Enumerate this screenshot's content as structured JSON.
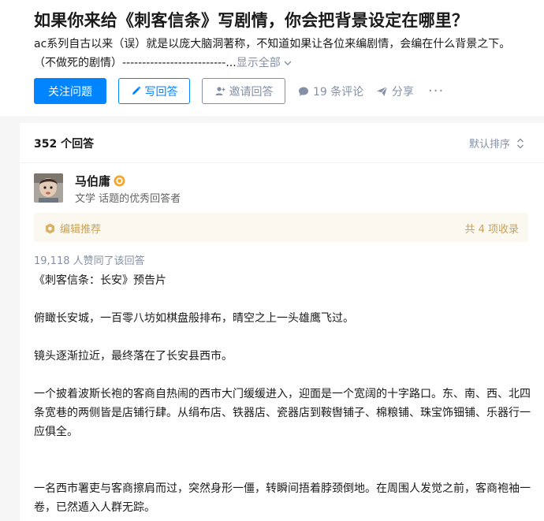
{
  "question": {
    "title": "如果你来给《刺客信条》写剧情，你会把背景设定在哪里？",
    "detail_line1": "ac系列自古以来（误）就是以庞大脑洞著称，不知道如果让各位来编剧情，会编在什么背景之下。",
    "detail_line2": "（不做死的剧情）--------------------------...",
    "show_all": "显示全部"
  },
  "actions": {
    "follow": "关注问题",
    "write": "写回答",
    "invite": "邀请回答",
    "comments": "19 条评论",
    "share": "分享",
    "more": "···"
  },
  "answers_header": {
    "count": "352 个回答",
    "sort": "默认排序"
  },
  "answer": {
    "author_name": "马伯庸",
    "author_desc": "文学 话题的优秀回答者",
    "editor_label": "编辑推荐",
    "editor_count": "共 4 项收录",
    "votes": "19,118 人赞同了该回答",
    "paragraphs": [
      "《刺客信条：长安》预告片",
      "",
      "俯瞰长安城，一百零八坊如棋盘般排布，晴空之上一头雄鹰飞过。",
      "",
      "镜头逐渐拉近，最终落在了长安县西市。",
      "",
      "一个披着波斯长袍的客商自热闹的西市大门缓缓进入，迎面是一个宽阔的十字路口。东、南、西、北四条宽巷的两侧皆是店铺行肆。从绢布店、铁器店、瓷器店到鞍辔铺子、棉粮铺、珠宝饰钿铺、乐器行一应俱全。",
      "",
      "",
      "一名西市署吏与客商擦肩而过，突然身形一僵，转瞬间捂着脖颈倒地。在周围人发觉之前，客商袍袖一卷，已然遁入人群无踪。"
    ]
  },
  "colors": {
    "primary": "#0084ff",
    "muted": "#8590a6",
    "editor_bg": "#fbf8f0",
    "editor_text": "#c8a25a",
    "badge": "#f5a623"
  },
  "icons": [
    "pencil-icon",
    "invite-user-icon",
    "comment-icon",
    "share-icon",
    "more-icon",
    "sort-icon",
    "verified-badge-icon",
    "editor-badge-icon",
    "chevron-down-icon"
  ]
}
